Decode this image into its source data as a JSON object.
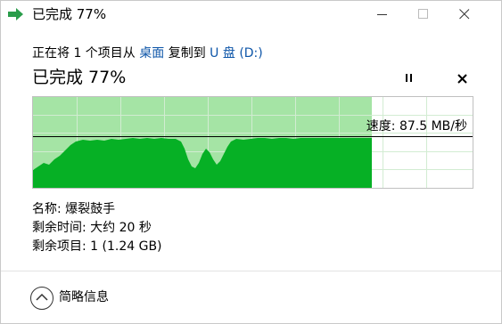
{
  "window": {
    "title": "已完成 77%",
    "accent_color": "#06b025"
  },
  "operation": {
    "prefix": "正在将 1 个项目从 ",
    "source": "桌面",
    "middle": " 复制到 ",
    "destination": "U 盘 (D:)"
  },
  "progress": {
    "status": "已完成 77%",
    "percent": 77,
    "speed": "速度: 87.5 MB/秒"
  },
  "details": {
    "name": "名称: 爆裂鼓手",
    "time_remaining": "剩余时间: 大约 20 秒",
    "items_remaining": "剩余项目: 1 (1.24 GB)"
  },
  "footer": {
    "less_details": "简略信息"
  },
  "icons": {
    "app": "copy-arrow-icon",
    "minimize": "minimize-icon",
    "maximize": "maximize-icon",
    "close": "close-icon",
    "pause": "pause-icon",
    "cancel": "cancel-icon",
    "collapse": "chevron-up-icon"
  }
}
